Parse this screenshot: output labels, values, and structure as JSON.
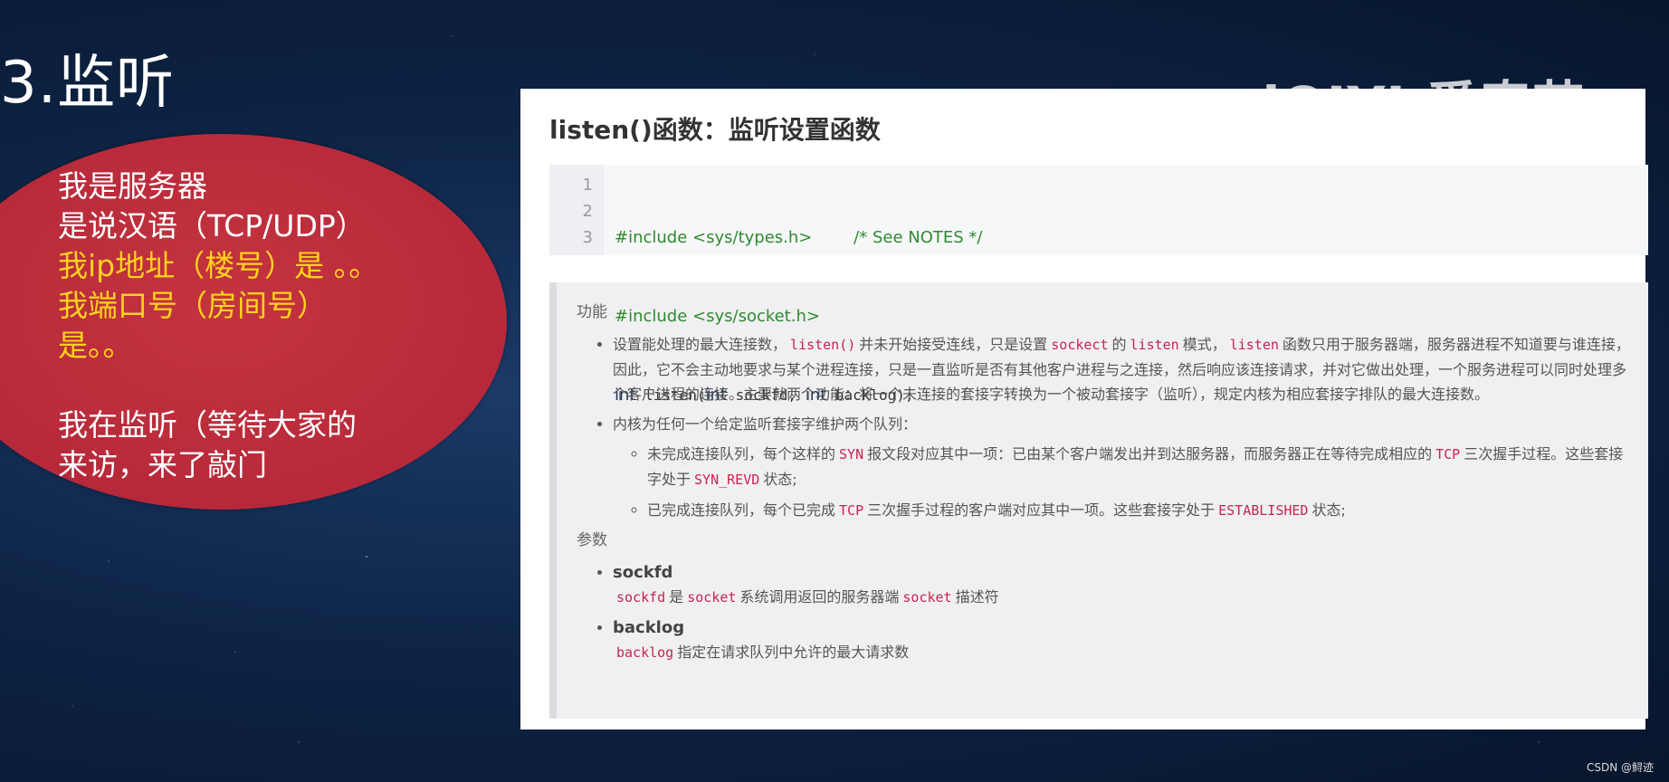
{
  "slide": {
    "title": "3.监听"
  },
  "bubble": {
    "lines": [
      {
        "text": "我是服务器",
        "style": "white"
      },
      {
        "text": "是说汉语（TCP/UDP）",
        "style": "white"
      },
      {
        "text": "我ip地址（楼号）是 。。",
        "style": "yellow"
      },
      {
        "text": "我端口号（房间号）",
        "style": "yellow"
      },
      {
        "text": "是。。",
        "style": "yellow"
      },
      {
        "text": "我在监听（等待大家的",
        "style": "white"
      },
      {
        "text": "来访，来了敲门",
        "style": "white"
      }
    ]
  },
  "watermark": "iQIYI 爱奇艺",
  "panel": {
    "heading": "listen()函数：监听设置函数",
    "code": {
      "line_numbers": [
        "1",
        "2",
        "3"
      ],
      "line1_include": "#include <sys/types.h>",
      "line1_comment": "/* See NOTES */",
      "line2_include": "#include <sys/socket.h>",
      "line3_kw_int": "int",
      "line3_fn": " listen(",
      "line3_kw_int2": "int",
      "line3_arg1": " sockfd, ",
      "line3_kw_int3": "int",
      "line3_arg2": " backlog);"
    },
    "notes": {
      "func_heading": "功能",
      "bullet1_part1": "设置能处理的最大连接数，",
      "bullet1_code1": "listen()",
      "bullet1_part2": "并未开始接受连线，只是设置",
      "bullet1_code2": "sockect",
      "bullet1_part3": "的",
      "bullet1_code3": "listen",
      "bullet1_part4": "模式，",
      "bullet1_code4": "listen",
      "bullet1_part5": "函数只用于服务器端，服务器进程不知道要与谁连接，因此，它不会主动地要求与某个进程连接，只是一直监听是否有其他客户进程与之连接，然后响应该连接请求，并对它做出处理，一个服务进程可以同时处理多个客户进程的连接。主要就两个功能：将一个未连接的套接字转换为一个被动套接字（监听），规定内核为相应套接字排队的最大连接数。",
      "bullet2": "内核为任何一个给定监听套接字维护两个队列：",
      "sub1_part1": "未完成连接队列，每个这样的",
      "sub1_code1": "SYN",
      "sub1_part2": "报文段对应其中一项：已由某个客户端发出并到达服务器，而服务器正在等待完成相应的",
      "sub1_code2": "TCP",
      "sub1_part3": "三次握手过程。这些套接字处于",
      "sub1_code3": "SYN_REVD",
      "sub1_part4": "状态;",
      "sub2_part1": "已完成连接队列，每个已完成",
      "sub2_code1": "TCP",
      "sub2_part2": "三次握手过程的客户端对应其中一项。这些套接字处于",
      "sub2_code2": "ESTABLISHED",
      "sub2_part3": "状态;",
      "params_heading": "参数",
      "param1_name": "sockfd",
      "param1_code1": "sockfd",
      "param1_part1": "是",
      "param1_code2": "socket",
      "param1_part2": "系统调用返回的服务器端",
      "param1_code3": "socket",
      "param1_part3": "描述符",
      "param2_name": "backlog",
      "param2_code1": "backlog",
      "param2_part1": "指定在请求队列中允许的最大请求数"
    }
  },
  "credit": "CSDN @鲟迹"
}
